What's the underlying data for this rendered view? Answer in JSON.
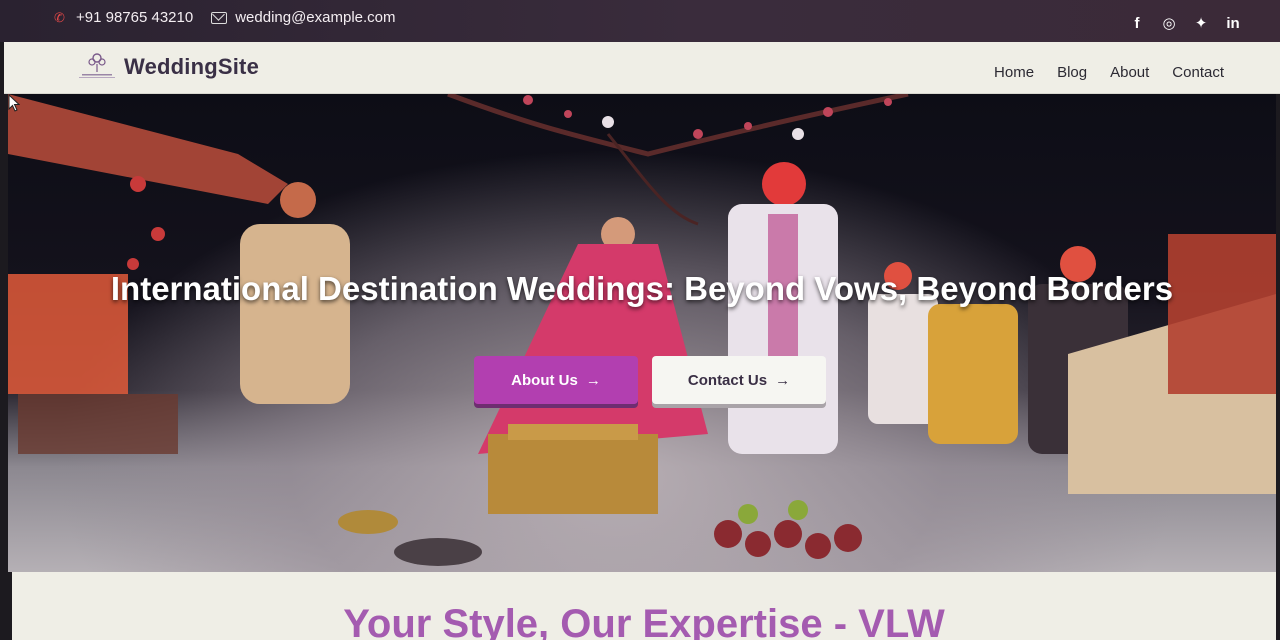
{
  "topbar": {
    "phone": "+91 98765 43210",
    "email": "wedding@example.com",
    "social": [
      {
        "icon": "facebook-icon",
        "glyph": "f"
      },
      {
        "icon": "instagram-icon",
        "glyph": "◎"
      },
      {
        "icon": "twitter-icon",
        "glyph": "✦"
      },
      {
        "icon": "linkedin-icon",
        "glyph": "in"
      }
    ]
  },
  "navbar": {
    "brand": "WeddingSite",
    "links": [
      "Home",
      "Blog",
      "About",
      "Contact"
    ]
  },
  "hero": {
    "title": "International Destination Weddings: Beyond Vows, Beyond Borders",
    "buttons": {
      "about": "About Us",
      "contact": "Contact Us",
      "arrow": "→"
    }
  },
  "section": {
    "title": "Your Style, Our Expertise - VLW"
  },
  "colors": {
    "accent": "#b23fb0",
    "section_title": "#a45bb0",
    "topbar": "#2a2230",
    "navbar": "#efeee6"
  }
}
